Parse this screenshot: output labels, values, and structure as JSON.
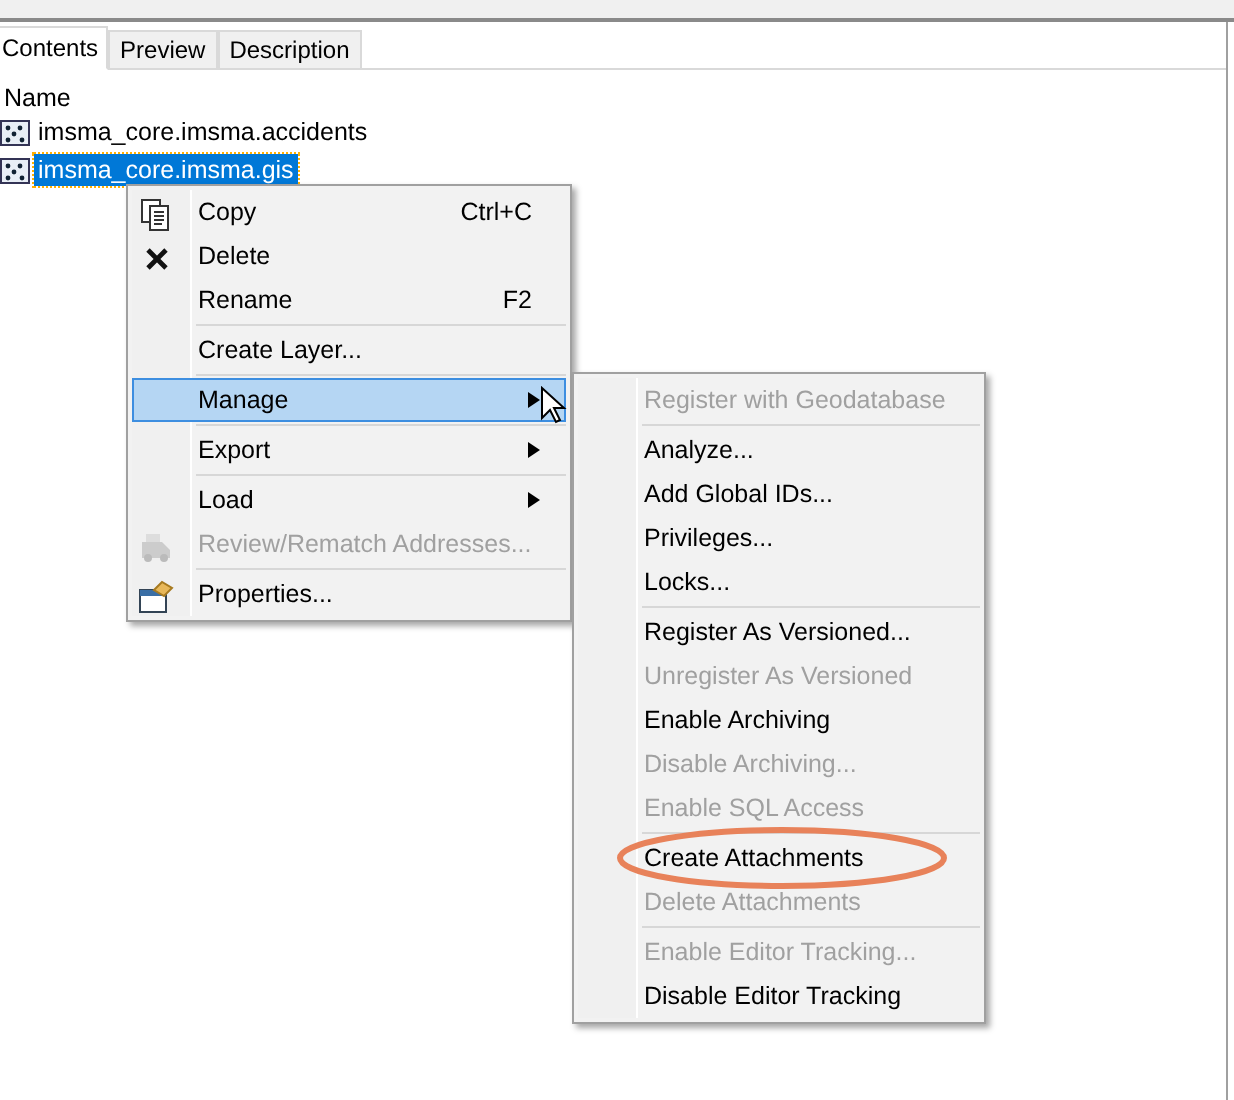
{
  "tabs": [
    {
      "label": "Contents",
      "selected": true
    },
    {
      "label": "Preview",
      "selected": false
    },
    {
      "label": "Description",
      "selected": false
    }
  ],
  "tree": {
    "header": "Name",
    "items": [
      {
        "label": "imsma_core.imsma.accidents",
        "selected": false
      },
      {
        "label": "imsma_core.imsma.gis",
        "selected": true
      }
    ]
  },
  "context_menu": {
    "items": [
      {
        "kind": "item",
        "label": "Copy",
        "shortcut": "Ctrl+C",
        "disabled": false,
        "submenu": false,
        "selected": false
      },
      {
        "kind": "item",
        "label": "Delete",
        "disabled": false,
        "submenu": false,
        "selected": false
      },
      {
        "kind": "item",
        "label": "Rename",
        "shortcut": "F2",
        "disabled": false,
        "submenu": false,
        "selected": false
      },
      {
        "kind": "separator"
      },
      {
        "kind": "item",
        "label": "Create Layer...",
        "disabled": false,
        "submenu": false,
        "selected": false
      },
      {
        "kind": "separator"
      },
      {
        "kind": "item",
        "label": "Manage",
        "disabled": false,
        "submenu": true,
        "selected": true
      },
      {
        "kind": "separator"
      },
      {
        "kind": "item",
        "label": "Export",
        "disabled": false,
        "submenu": true,
        "selected": false
      },
      {
        "kind": "separator"
      },
      {
        "kind": "item",
        "label": "Load",
        "disabled": false,
        "submenu": true,
        "selected": false
      },
      {
        "kind": "item",
        "label": "Review/Rematch Addresses...",
        "disabled": true,
        "submenu": false,
        "selected": false
      },
      {
        "kind": "separator"
      },
      {
        "kind": "item",
        "label": "Properties...",
        "disabled": false,
        "submenu": false,
        "selected": false
      }
    ]
  },
  "submenu": {
    "items": [
      {
        "kind": "item",
        "label": "Register with Geodatabase",
        "disabled": true,
        "circled": false
      },
      {
        "kind": "separator"
      },
      {
        "kind": "item",
        "label": "Analyze...",
        "disabled": false,
        "circled": false
      },
      {
        "kind": "item",
        "label": "Add Global IDs...",
        "disabled": false,
        "circled": false
      },
      {
        "kind": "item",
        "label": "Privileges...",
        "disabled": false,
        "circled": false
      },
      {
        "kind": "item",
        "label": "Locks...",
        "disabled": false,
        "circled": false
      },
      {
        "kind": "separator"
      },
      {
        "kind": "item",
        "label": "Register As Versioned...",
        "disabled": false,
        "circled": false
      },
      {
        "kind": "item",
        "label": "Unregister As Versioned",
        "disabled": true,
        "circled": false
      },
      {
        "kind": "item",
        "label": "Enable Archiving",
        "disabled": false,
        "circled": false
      },
      {
        "kind": "item",
        "label": "Disable Archiving...",
        "disabled": true,
        "circled": false
      },
      {
        "kind": "item",
        "label": "Enable SQL Access",
        "disabled": true,
        "circled": false
      },
      {
        "kind": "separator"
      },
      {
        "kind": "item",
        "label": "Create Attachments",
        "disabled": false,
        "circled": true
      },
      {
        "kind": "item",
        "label": "Delete Attachments",
        "disabled": true,
        "circled": false
      },
      {
        "kind": "separator"
      },
      {
        "kind": "item",
        "label": "Enable Editor Tracking...",
        "disabled": true,
        "circled": false
      },
      {
        "kind": "item",
        "label": "Disable Editor Tracking",
        "disabled": false,
        "circled": false
      }
    ]
  }
}
